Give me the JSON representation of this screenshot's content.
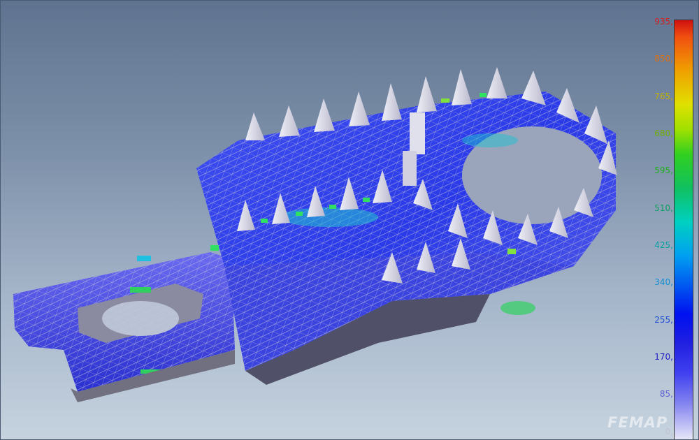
{
  "viewport": {
    "background": "#7e91aa"
  },
  "model": {
    "subject": "footpeg-fea-mesh",
    "mesh_color": "#c8c8d8",
    "low_stress_color": "#2a3ae8",
    "high_stress_color": "#20d060"
  },
  "legend": {
    "labels": [
      {
        "text": "935,",
        "color": "#d02020"
      },
      {
        "text": "850,",
        "color": "#e07010"
      },
      {
        "text": "765,",
        "color": "#c0b000"
      },
      {
        "text": "680,",
        "color": "#70b000"
      },
      {
        "text": "595,",
        "color": "#20b020"
      },
      {
        "text": "510,",
        "color": "#10a060"
      },
      {
        "text": "425,",
        "color": "#00a0a0"
      },
      {
        "text": "340,",
        "color": "#1090d0"
      },
      {
        "text": "255,",
        "color": "#2050d0"
      },
      {
        "text": "170,",
        "color": "#2020c0"
      },
      {
        "text": "85,",
        "color": "#6060d0"
      },
      {
        "text": "0,",
        "color": "#c0c0d0"
      }
    ],
    "colors": [
      "#d01010",
      "#f0a000",
      "#e0e000",
      "#30d020",
      "#00d0c0",
      "#00a0f0",
      "#0010f0",
      "#e8e8f8"
    ]
  },
  "watermark": {
    "text": "FEMAP"
  }
}
